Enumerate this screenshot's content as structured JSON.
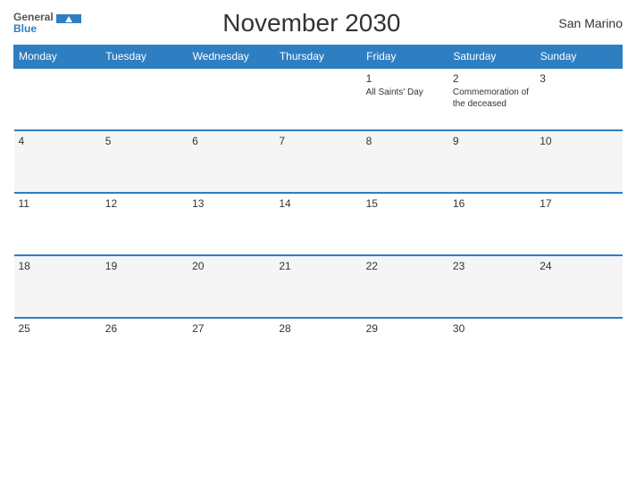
{
  "header": {
    "logo_general": "General",
    "logo_blue": "Blue",
    "title": "November 2030",
    "region": "San Marino"
  },
  "weekdays": [
    "Monday",
    "Tuesday",
    "Wednesday",
    "Thursday",
    "Friday",
    "Saturday",
    "Sunday"
  ],
  "weeks": [
    [
      {
        "day": "",
        "events": []
      },
      {
        "day": "",
        "events": []
      },
      {
        "day": "",
        "events": []
      },
      {
        "day": "",
        "events": []
      },
      {
        "day": "1",
        "events": [
          "All Saints' Day"
        ]
      },
      {
        "day": "2",
        "events": [
          "Commemoration of the deceased"
        ]
      },
      {
        "day": "3",
        "events": []
      }
    ],
    [
      {
        "day": "4",
        "events": []
      },
      {
        "day": "5",
        "events": []
      },
      {
        "day": "6",
        "events": []
      },
      {
        "day": "7",
        "events": []
      },
      {
        "day": "8",
        "events": []
      },
      {
        "day": "9",
        "events": []
      },
      {
        "day": "10",
        "events": []
      }
    ],
    [
      {
        "day": "11",
        "events": []
      },
      {
        "day": "12",
        "events": []
      },
      {
        "day": "13",
        "events": []
      },
      {
        "day": "14",
        "events": []
      },
      {
        "day": "15",
        "events": []
      },
      {
        "day": "16",
        "events": []
      },
      {
        "day": "17",
        "events": []
      }
    ],
    [
      {
        "day": "18",
        "events": []
      },
      {
        "day": "19",
        "events": []
      },
      {
        "day": "20",
        "events": []
      },
      {
        "day": "21",
        "events": []
      },
      {
        "day": "22",
        "events": []
      },
      {
        "day": "23",
        "events": []
      },
      {
        "day": "24",
        "events": []
      }
    ],
    [
      {
        "day": "25",
        "events": []
      },
      {
        "day": "26",
        "events": []
      },
      {
        "day": "27",
        "events": []
      },
      {
        "day": "28",
        "events": []
      },
      {
        "day": "29",
        "events": []
      },
      {
        "day": "30",
        "events": []
      },
      {
        "day": "",
        "events": []
      }
    ]
  ]
}
